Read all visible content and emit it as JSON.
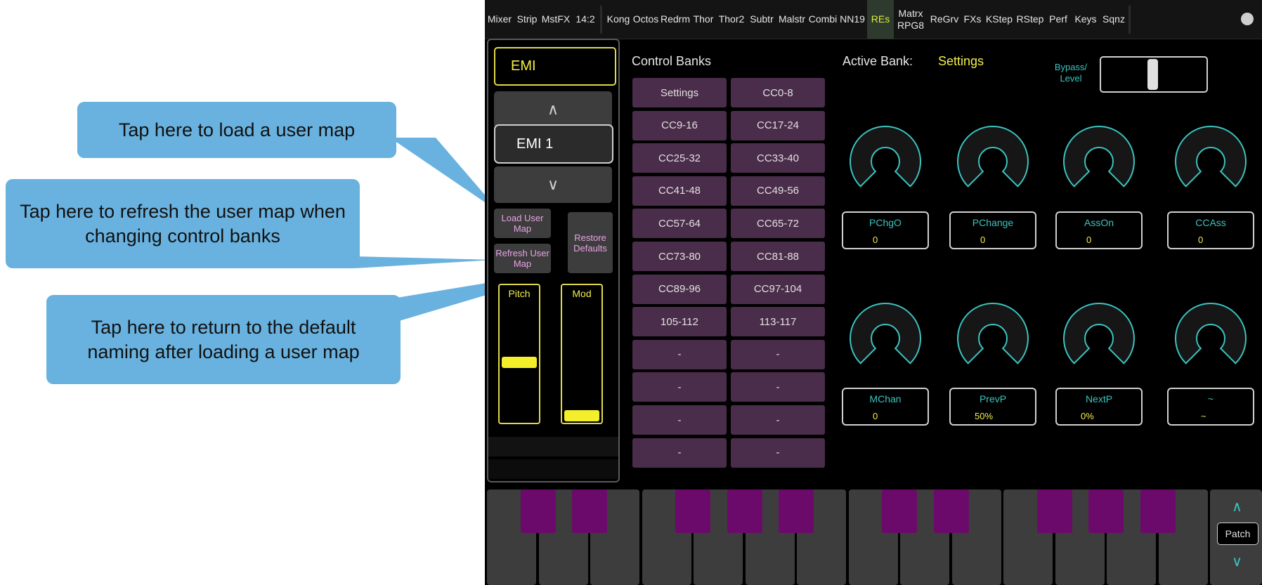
{
  "tabs": [
    {
      "label": "Mixer",
      "active": false
    },
    {
      "label": "Strip",
      "active": false
    },
    {
      "label": "MstFX",
      "active": false
    },
    {
      "label": "14:2",
      "active": false
    },
    {
      "label": "Kong",
      "active": false
    },
    {
      "label": "Octos",
      "active": false
    },
    {
      "label": "Redrm",
      "active": false
    },
    {
      "label": "Thor",
      "active": false
    },
    {
      "label": "Thor2",
      "active": false
    },
    {
      "label": "Subtr",
      "active": false
    },
    {
      "label": "Malstr",
      "active": false
    },
    {
      "label": "Combi",
      "active": false
    },
    {
      "label": "NN19",
      "active": false
    },
    {
      "label": "REs",
      "active": true
    },
    {
      "label": "Matrx\nRPG8",
      "active": false
    },
    {
      "label": "ReGrv",
      "active": false
    },
    {
      "label": "FXs",
      "active": false
    },
    {
      "label": "KStep",
      "active": false
    },
    {
      "label": "RStep",
      "active": false
    },
    {
      "label": "Perf",
      "active": false
    },
    {
      "label": "Keys",
      "active": false
    },
    {
      "label": "Sqnz",
      "active": false
    }
  ],
  "left_panel": {
    "device_name": "EMI",
    "up_arrow": "∧",
    "map_name": "EMI 1",
    "down_arrow": "∨",
    "load_user_map": "Load User Map",
    "refresh_user_map": "Refresh User Map",
    "restore_defaults": "Restore Defaults",
    "pitch": {
      "label": "Pitch",
      "level": 0.5
    },
    "mod": {
      "label": "Mod",
      "level": 0.0
    }
  },
  "control_banks": {
    "title": "Control Banks",
    "banks": [
      "Settings",
      "CC0-8",
      "CC9-16",
      "CC17-24",
      "CC25-32",
      "CC33-40",
      "CC41-48",
      "CC49-56",
      "CC57-64",
      "CC65-72",
      "CC73-80",
      "CC81-88",
      "CC89-96",
      "CC97-104",
      "105-112",
      "113-117",
      "-",
      "-",
      "-",
      "-",
      "-",
      "-",
      "-",
      "-"
    ]
  },
  "active_bank": {
    "label": "Active Bank:",
    "value": "Settings",
    "bypass_label": "Bypass/ Level",
    "bypass_position": 0.5
  },
  "params": [
    {
      "name": "PChgO",
      "value": "0"
    },
    {
      "name": "PChange",
      "value": "0"
    },
    {
      "name": "AssOn",
      "value": "0"
    },
    {
      "name": "CCAss",
      "value": "0"
    },
    {
      "name": "MChan",
      "value": "0"
    },
    {
      "name": "PrevP",
      "value": "50%"
    },
    {
      "name": "NextP",
      "value": "0%"
    },
    {
      "name": "~",
      "value": "~"
    }
  ],
  "patch": {
    "up": "∧",
    "label": "Patch",
    "down": "∨"
  },
  "callouts": {
    "load": "Tap here to load a user map",
    "refresh": "Tap here to refresh the user map when changing control banks",
    "restore": "Tap here to return to the default naming after loading a user map"
  },
  "colors": {
    "accent_yellow": "#f3ef4a",
    "teal": "#3bc4c0",
    "bank_purple": "#4a2d4a",
    "black_key": "#6b0a6b",
    "callout_blue": "#69b2df"
  }
}
